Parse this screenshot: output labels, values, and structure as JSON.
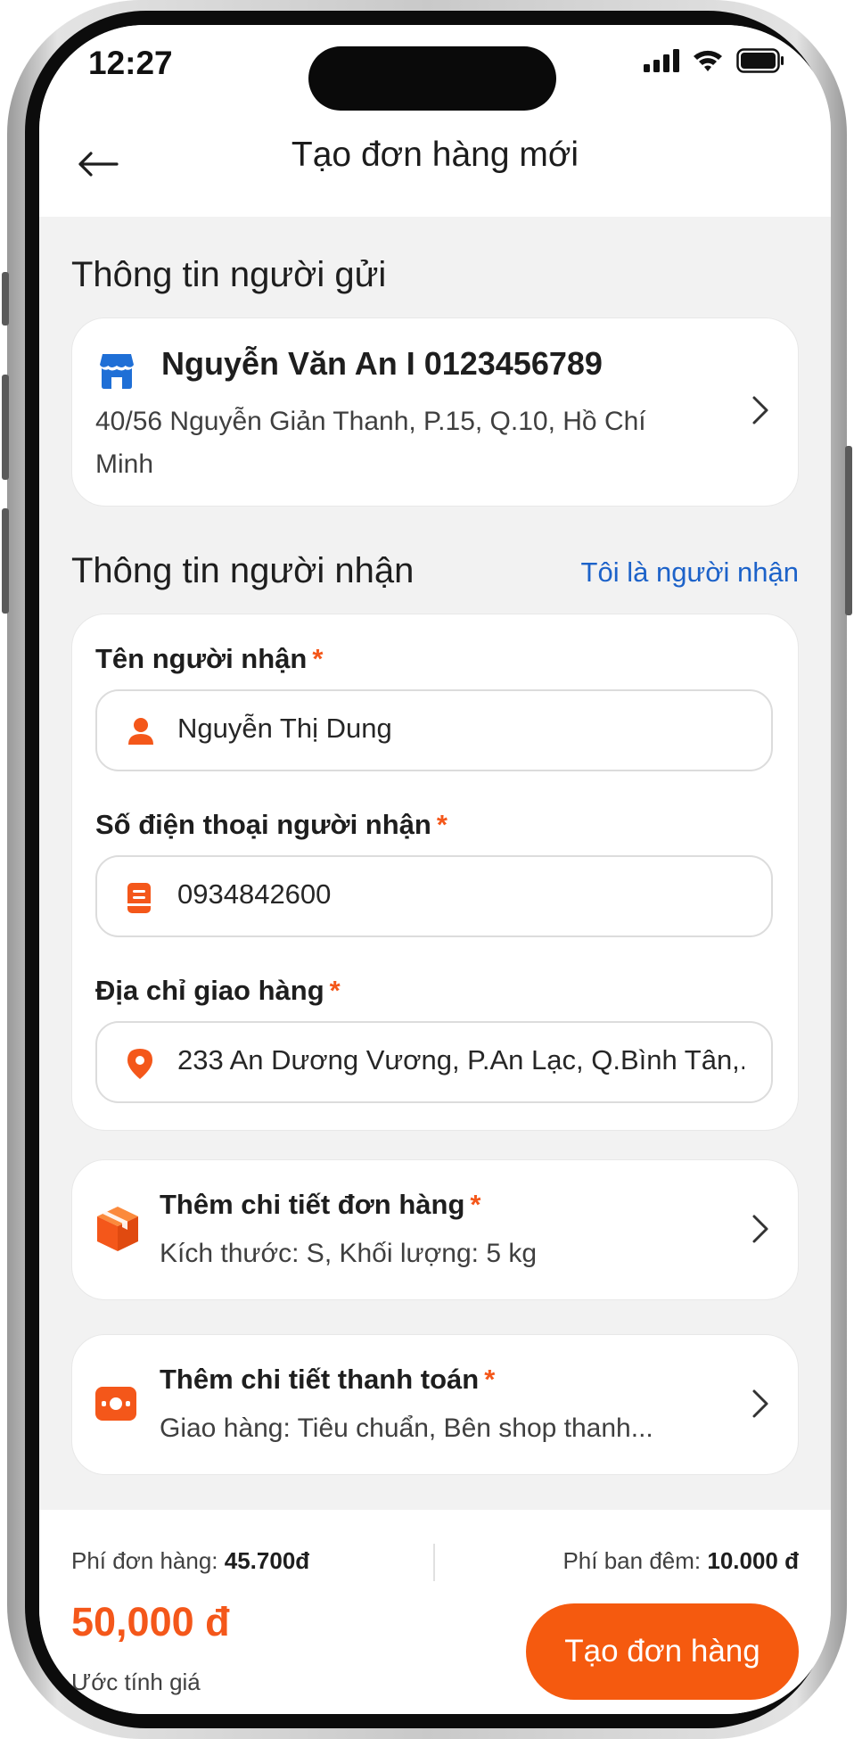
{
  "status_bar": {
    "time": "12:27"
  },
  "header": {
    "title": "Tạo đơn hàng mới"
  },
  "sender": {
    "section_title": "Thông tin người gửi",
    "name_phone": "Nguyễn Văn An I 0123456789",
    "address": "40/56 Nguyễn Giản Thanh, P.15, Q.10, Hồ Chí Minh",
    "icon": "store-icon"
  },
  "receiver": {
    "section_title": "Thông tin người nhận",
    "self_link": "Tôi là người nhận",
    "name_label": "Tên người nhận",
    "name_value": "Nguyễn Thị Dung",
    "phone_label": "Số điện thoại người nhận",
    "phone_value": "0934842600",
    "address_label": "Địa chỉ giao hàng",
    "address_value": "233 An Dương Vương, P.An Lạc, Q.Bình Tân,...",
    "required_mark": "*"
  },
  "order_details": {
    "title": "Thêm chi tiết đơn hàng",
    "summary": "Kích thước: S, Khối lượng: 5 kg",
    "icon": "package-icon"
  },
  "payment_details": {
    "title": "Thêm chi tiết thanh toán",
    "summary": "Giao hàng: Tiêu chuẩn, Bên shop thanh...",
    "icon": "cash-icon"
  },
  "footer": {
    "order_fee_label": "Phí đơn hàng:",
    "order_fee_value": "45.700đ",
    "night_fee_label": "Phí ban đêm:",
    "night_fee_value": "10.000 đ",
    "total": "50,000 đ",
    "total_caption": "Ước tính giá",
    "create_button": "Tạo đơn hàng"
  },
  "colors": {
    "accent": "#f55a0f",
    "link": "#1c62c9",
    "store_icon": "#1f6fd6"
  }
}
